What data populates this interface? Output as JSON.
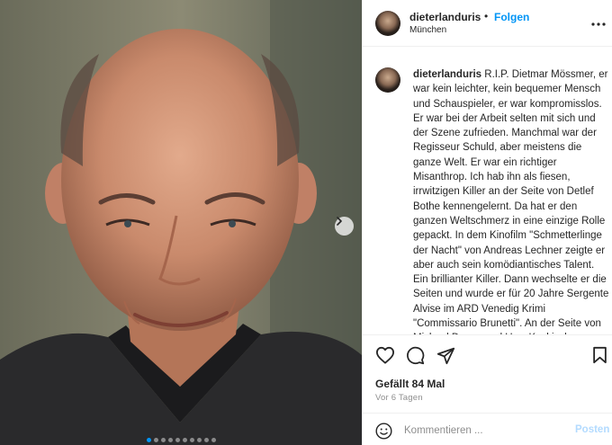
{
  "photo": {
    "carousel_total": 10,
    "carousel_active": 1,
    "next_icon": "chevron-right-icon"
  },
  "header": {
    "username": "dieterlanduris",
    "separator": "•",
    "follow_label": "Folgen",
    "location": "München",
    "more_icon": "more-horizontal-icon"
  },
  "caption": {
    "username": "dieterlanduris",
    "text": "R.I.P. Dietmar Mössmer, er war kein leichter, kein bequemer Mensch und Schauspieler, er war kompromisslos. Er war bei der Arbeit selten mit sich und der Szene zufrieden. Manchmal war der Regisseur Schuld, aber meistens die ganze Welt. Er war ein richtiger Misanthrop. Ich hab ihn als fiesen, irrwitzigen Killer an der Seite von Detlef Bothe kennengelernt. Da hat er den ganzen Weltschmerz in eine einzige Rolle gepackt. In dem Kinofilm \"Schmetterlinge der Nacht\" von Andreas Lechner zeigte er aber auch sein komödiantisches Talent. Ein brillianter Killer. Dann wechselte er die Seiten und wurde er für 20 Jahre Sergente Alvise im ARD Venedig Krimi \"Commissario Brunetti\". An der Seite von Michael Degen und Uwe Kockisch war er nicht wegzudenken."
  },
  "actions": {
    "icons": [
      "heart-icon",
      "comment-icon",
      "share-icon",
      "bookmark-icon"
    ],
    "likes": "Gefällt 84 Mal",
    "time": "Vor 6 Tagen"
  },
  "comment": {
    "placeholder": "Kommentieren ...",
    "post_label": "Posten",
    "emoji_icon": "emoji-icon"
  },
  "colors": {
    "accent": "#0095f6",
    "post_disabled": "#b3dbff",
    "muted": "#8e8e8e",
    "divider": "#efefef"
  }
}
